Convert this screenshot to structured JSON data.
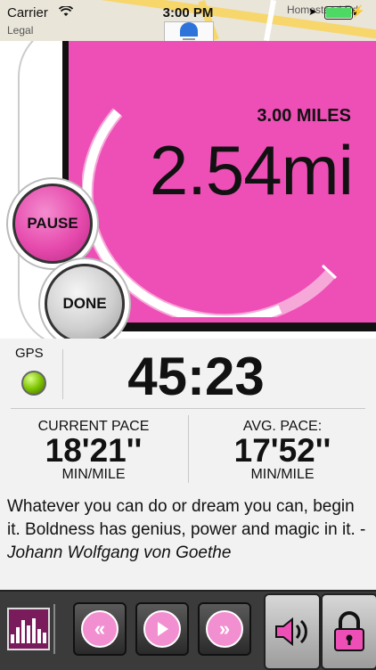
{
  "status_bar": {
    "carrier": "Carrier",
    "time": "3:00 PM",
    "map_street": "Homestead Rd",
    "map_legal": "Legal",
    "battery_color": "#4cd964"
  },
  "run": {
    "goal_label": "3.00 MILES",
    "distance": "2.54mi",
    "progress_fraction": 0.847,
    "pause_label": "PAUSE",
    "done_label": "DONE"
  },
  "stats": {
    "gps_label": "GPS",
    "gps_status_color": "#7fc400",
    "elapsed": "45:23",
    "current_pace_label": "CURRENT PACE",
    "current_pace_value": "18'21''",
    "current_pace_unit": "MIN/MILE",
    "avg_pace_label": "AVG. PACE:",
    "avg_pace_value": "17'52''",
    "avg_pace_unit": "MIN/MILE"
  },
  "quote": {
    "text": "Whatever you can do or dream you can, begin it. Boldness has genius, power and magic in it. - ",
    "author": "Johann Wolfgang von Goethe"
  },
  "toolbar": {
    "items": [
      "playlist-icon",
      "rewind-icon",
      "play-icon",
      "fast-forward-icon",
      "volume-icon",
      "lock-icon"
    ]
  },
  "colors": {
    "accent_pink": "#ee4fb6",
    "button_pink": "#f28fd0"
  }
}
